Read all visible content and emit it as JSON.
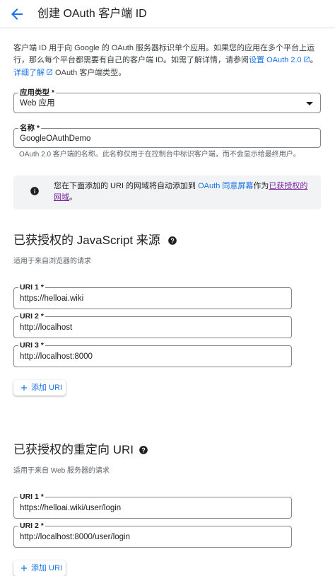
{
  "header": {
    "title": "创建 OAuth 客户端 ID"
  },
  "intro": {
    "text1": "客户端 ID 用于向 Google 的 OAuth 服务器标识单个应用。如果您的应用在多个平台上运行，那么每个平台都需要有自己的客户端 ID。如需了解详情，请参阅",
    "link1": "设置 OAuth 2.0",
    "text2": "。",
    "link2": "详细了解",
    "text3": " OAuth 客户端类型。"
  },
  "app_type": {
    "label": "应用类型 *",
    "value": "Web 应用"
  },
  "name_field": {
    "label": "名称 *",
    "value": "GoogleOAuthDemo",
    "hint": "OAuth 2.0 客户端的名称。此名称仅用于在控制台中标识客户端，而不会显示给最终用户。"
  },
  "notice": {
    "text1": "您在下面添加的 URI 的网域将自动添加到 ",
    "link1": "OAuth 同意屏幕",
    "text2": "作为",
    "link2": "已获授权的网域",
    "text3": "。"
  },
  "js_origins": {
    "title": "已获授权的 JavaScript 来源",
    "subtitle": "适用于来自浏览器的请求",
    "uris": [
      {
        "label": "URI 1 *",
        "value": "https://helloai.wiki"
      },
      {
        "label": "URI 2 *",
        "value": "http://localhost"
      },
      {
        "label": "URI 3 *",
        "value": "http://localhost:8000"
      }
    ],
    "add_label": "添加 URI"
  },
  "redirect_uris": {
    "title": "已获授权的重定向 URI",
    "subtitle": "适用于来自 Web 服务器的请求",
    "uris": [
      {
        "label": "URI 1 *",
        "value": "https://helloai.wiki/user/login"
      },
      {
        "label": "URI 2 *",
        "value": "http://localhost:8000/user/login"
      }
    ],
    "add_label": "添加 URI"
  },
  "colors": {
    "accent": "#1a73e8",
    "visited_link": "#7b1fa2",
    "notice_bg": "#f1f3f4",
    "border": "#80868b"
  },
  "icons": {
    "back": "arrow-back-icon",
    "external": "external-link-icon",
    "dropdown": "dropdown-arrow-icon",
    "info": "info-icon",
    "help": "help-icon",
    "add": "plus-icon"
  }
}
